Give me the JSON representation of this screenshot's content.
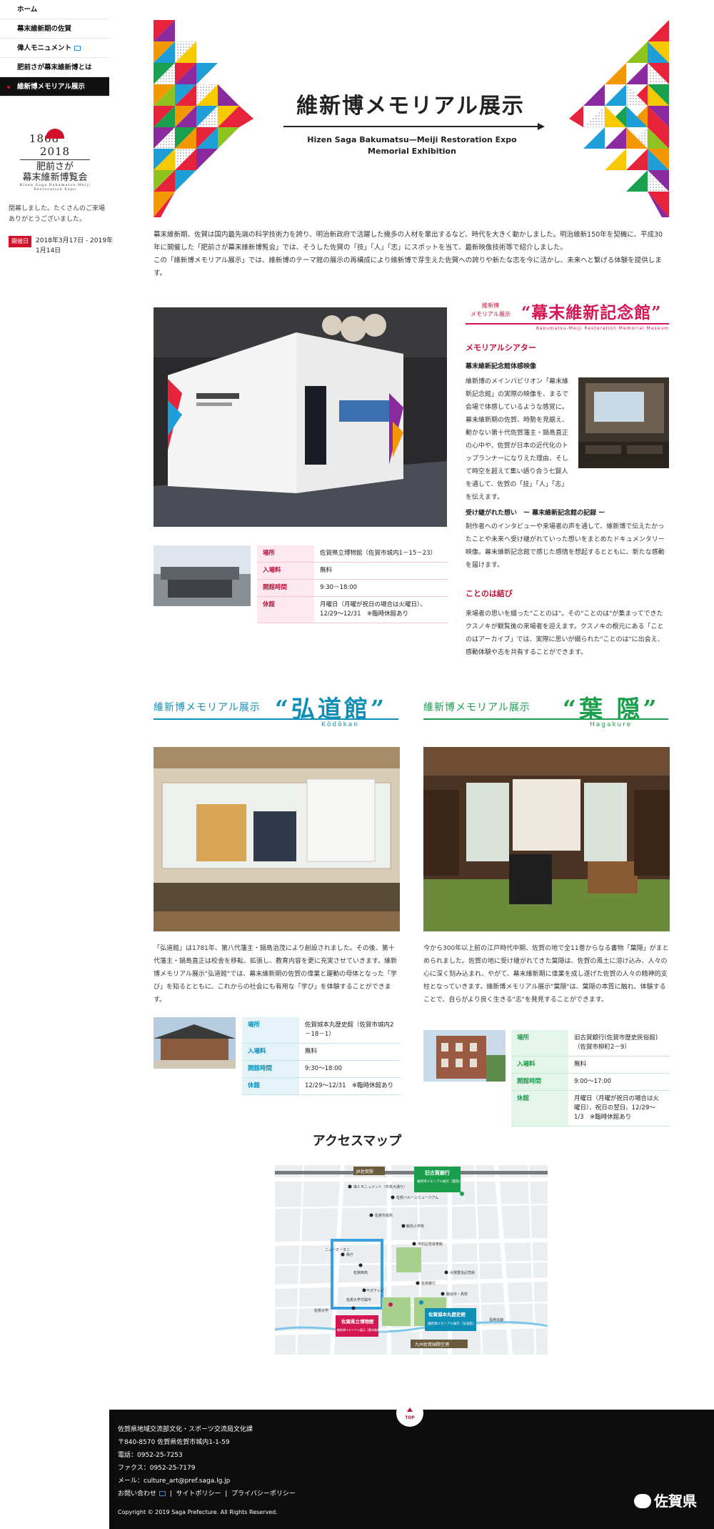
{
  "sidebar": {
    "nav": [
      {
        "label": "ホーム"
      },
      {
        "label": "幕末維新期の佐賀"
      },
      {
        "label": "偉人モニュメント"
      },
      {
        "label": "肥前さが幕末維新博とは"
      },
      {
        "label": "維新博メモリアル展示"
      }
    ],
    "logo": {
      "years_left": "1868",
      "years_right": "2018",
      "line1": "肥前さが",
      "line2": "幕末維新博覧会",
      "small": "Hizen Saga Bakumatsu-Meiji Restoration Expo"
    },
    "closed_message": "閉幕しました。たくさんのご来場ありがとうございました。",
    "period_badge": "開催日",
    "period": "2018年3月17日 - 2019年1月14日"
  },
  "hero": {
    "title": "維新博メモリアル展示",
    "subtitle_1": "Hizen Saga Bakumatsu—Meiji Restoration Expo",
    "subtitle_2": "Memorial Exhibition"
  },
  "intro": {
    "p1": "幕末維新期、佐賀は国内最先端の科学技術力を誇り、明治新政府で活躍した幾多の人材を輩出するなど、時代を大きく動かしました。明治維新150年を契機に、平成30年に開催した「肥前さが幕末維新博覧会」では、そうした佐賀の「技」「人」「志」にスポットを当て、最新映像技術等で紹介しました。",
    "p2": "この「維新博メモリアル展示」では、維新博のテーマ館の展示の再構成により維新博で芽生えた佐賀への誇りや新たな志を今に活かし、未来へと繋げる体験を提供します。"
  },
  "memorial_hall": {
    "label_top": "維新博",
    "label_bottom": "メモリアル展示",
    "name": "“幕末維新記念館”",
    "english": "Bakumatsu-Meiji Restoration Memorial Museum",
    "h_theater": "メモリアルシアター",
    "h_video": "幕末維新記念館体感映像",
    "p_video": "維新博のメインパビリオン「幕末維新記念館」の実際の映像を、まるで会場で体感しているような感覚に。幕末維新期の佐賀、時勢を見据え、動かない第十代佐賀藩主・鍋島直正の心中や、佐賀が日本の近代化のトップランナーになりえた理由、そして時空を超えて集い語り合う七賢人を通して、佐賀の「技」「人」「志」を伝えます。",
    "h_record": "受け継がれた想い　ー 幕末維新記念館の記録 ー",
    "p_record": "制作者へのインタビューや来場者の声を通して、維新博で伝えたかったことや未来へ受け継がれていった想いをまとめたドキュメンタリー映像。幕末維新記念館で感じた感情を想起するとともに、新たな感動を届けます。",
    "h_words": "ことのは結び",
    "p_words": "来場者の思いを綴った\"ことのは\"。その\"ことのは\"が集まってできたクスノキが観覧後の来場者を迎えます。クスノキの根元にある「ことのはアーカイブ」では、実際に思いが綴られた\"ことのは\"に出会え、感動体験や志を共有することができます。",
    "info": [
      {
        "k": "場所",
        "v": "佐賀県立博物館（佐賀市城内1－15－23）"
      },
      {
        "k": "入場料",
        "v": "無料"
      },
      {
        "k": "開館時間",
        "v": "9:30－18:00"
      },
      {
        "k": "休館",
        "v": "月曜日（月曜が祝日の場合は火曜日）、12/29～12/31　※臨時休館あり"
      }
    ]
  },
  "kodokan": {
    "label": "維新博メモリアル展示",
    "name": "“弘道館”",
    "english": "Kōdōkan",
    "text": "「弘道館」は1781年、第八代藩主・鍋島治茂により創設されました。その後、第十代藩主・鍋島直正は校舎を移転、拡張し、教育内容を更に充実させていきます。維新博メモリアル展示\"弘道館\"では、幕末維新期の佐賀の偉業と躍動の母体となった「学び」を知るとともに、これからの社会にも有用な「学び」を体験することができます。",
    "info": [
      {
        "k": "場所",
        "v": "佐賀城本丸歴史館（佐賀市城内2－18－1）"
      },
      {
        "k": "入場料",
        "v": "無料"
      },
      {
        "k": "開館時間",
        "v": "9:30～18:00"
      },
      {
        "k": "休館",
        "v": "12/29～12/31　※臨時休館あり"
      }
    ]
  },
  "hagakure": {
    "label": "維新博メモリアル展示",
    "name": "“葉 隠”",
    "english": "Hagakure",
    "text": "今から300年以上前の江戸時代中期、佐賀の地で全11巻からなる書物「葉隠」がまとめられました。佐賀の地に受け継がれてきた葉隠は、佐賀の風土に溶け込み、人々の心に深く刻み込まれ、やがて、幕末維新期に偉業を成し遂げた佐賀の人々の精神的支柱となっていきます。維新博メモリアル展示\"葉隠\"は、葉隠の本質に触れ、体験することで、自らがより良く生きる\"志\"を発見することができます。",
    "info": [
      {
        "k": "場所",
        "v": "旧古賀銀行(佐賀市歴史民俗館)（佐賀市柳町2－9）"
      },
      {
        "k": "入場料",
        "v": "無料"
      },
      {
        "k": "開館時間",
        "v": "9:00～17:00"
      },
      {
        "k": "休館",
        "v": "月曜日（月曜が祝日の場合は火曜日）、祝日の翌日、12/29～1/3　※臨時休館あり"
      }
    ]
  },
  "access": {
    "title": "アクセスマップ",
    "map_labels": {
      "station": "JR佐賀駅",
      "koga_bank": "旧古賀銀行",
      "koga_sub": "維新博メモリアル展示［葉隠］",
      "museum": "佐賀県立博物館",
      "museum_sub": "維新博メモリアル展示［幕末維新記念館］",
      "castle": "佐賀城本丸歴史館",
      "castle_sub": "維新博メモリアル展示［弘道館］",
      "airport": "九州佐賀国際空港",
      "monument": "偉人モニュメント（中央大通り）",
      "elevan": "佐賀バルーンミュージアム",
      "city_hall": "佐賀市役所",
      "new_otani": "ニューオータニ",
      "saga_univ": "佐賀大学",
      "west_hs": "佐賀西高",
      "library": "県庁",
      "kenritsu": "佐賀大学付属中",
      "higashi": "大隈重信記念館",
      "shiyakusho": "市村記念体育館",
      "minamihs": "佐賀銀行",
      "arena": "サガテレビ",
      "nagase": "長崎本線",
      "kita": "鍋島小学校",
      "aoki": "龍谷中・高校"
    }
  },
  "footer": {
    "top": "TOP",
    "org": "佐賀県地域交流部文化・スポーツ交流局文化課",
    "address": "〒840-8570 佐賀県佐賀市城内1-1-59",
    "tel": "電話：0952-25-7253",
    "fax": "ファクス：0952-25-7179",
    "mail": "メール：culture_art@pref.saga.lg.jp",
    "links": [
      "お問い合わせ",
      "サイトポリシー",
      "プライバシーポリシー"
    ],
    "copyright": "Copyright © 2019 Saga Prefecture. All Rights Reserved.",
    "logo": "佐賀県"
  },
  "colors": {
    "accent": "#d41753",
    "kodokan": "#0e8fb5",
    "hagakure": "#1a9e4b",
    "footer_bg": "#0d0d0d"
  }
}
